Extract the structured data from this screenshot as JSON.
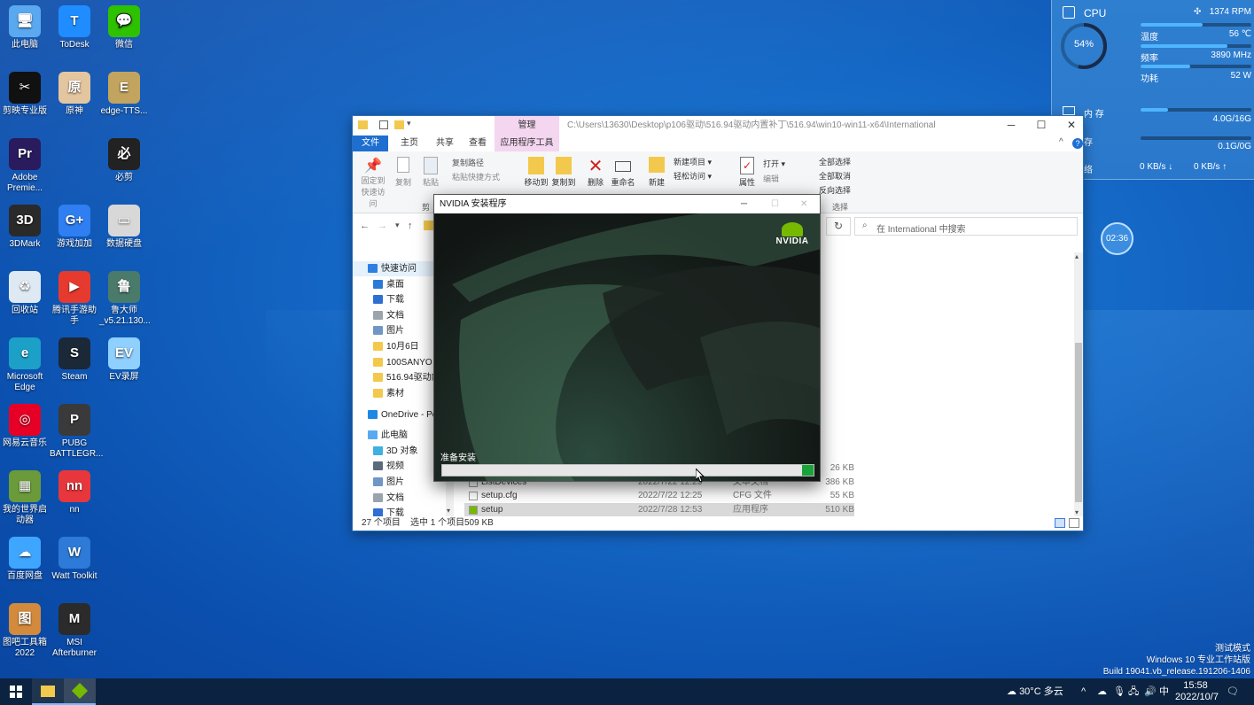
{
  "desktop": {
    "icons": [
      {
        "label": "此电脑",
        "color": "#5aa9f0",
        "glyph": "🖥"
      },
      {
        "label": "ToDesk",
        "color": "#1f8dff",
        "glyph": "T"
      },
      {
        "label": "微信",
        "color": "#2dc100",
        "glyph": "💬"
      },
      {
        "label": "剪映专业版",
        "color": "#111111",
        "glyph": "✂"
      },
      {
        "label": "原神",
        "color": "#e3c6a0",
        "glyph": "原"
      },
      {
        "label": "edge-TTS...",
        "color": "#c2a45e",
        "glyph": "E"
      },
      {
        "label": "Adobe Premie...",
        "color": "#2a1b5e",
        "glyph": "Pr"
      },
      {
        "label": "必剪",
        "color": "#222222",
        "glyph": "必"
      },
      {
        "label": "3DMark",
        "color": "#2a2a2a",
        "glyph": "3D"
      },
      {
        "label": "游戏加加",
        "color": "#2f7ff2",
        "glyph": "G+"
      },
      {
        "label": "数据硬盘",
        "color": "#d8d8d8",
        "glyph": "▭"
      },
      {
        "label": "回收站",
        "color": "#dfe9f3",
        "glyph": "♻"
      },
      {
        "label": "腾讯手游助手",
        "color": "#e63a2f",
        "glyph": "▶"
      },
      {
        "label": "鲁大师_v5.21.130...",
        "color": "#4a7a6a",
        "glyph": "鲁"
      },
      {
        "label": "Microsoft Edge",
        "color": "#1da0c8",
        "glyph": "e"
      },
      {
        "label": "Steam",
        "color": "#1b2838",
        "glyph": "S"
      },
      {
        "label": "EV录屏",
        "color": "#8fd0ff",
        "glyph": "EV"
      },
      {
        "label": "网易云音乐",
        "color": "#e60026",
        "glyph": "◎"
      },
      {
        "label": "PUBG BATTLEGR...",
        "color": "#3a3a3a",
        "glyph": "P"
      },
      {
        "label": "我的世界启动器",
        "color": "#6a9a3a",
        "glyph": "▦"
      },
      {
        "label": "nn",
        "color": "#e8373c",
        "glyph": "nn"
      },
      {
        "label": "百度网盘",
        "color": "#3fa6ff",
        "glyph": "☁"
      },
      {
        "label": "Watt Toolkit",
        "color": "#2d7ad8",
        "glyph": "W"
      },
      {
        "label": "图吧工具箱2022",
        "color": "#d48a3c",
        "glyph": "图"
      },
      {
        "label": "MSI Afterburner",
        "color": "#2b2b2b",
        "glyph": "M"
      }
    ]
  },
  "monitor": {
    "cpu_label": "CPU",
    "fan": "1374 RPM",
    "usage_percent": "54%",
    "usage_value": 0.54,
    "temp_label": "温度",
    "temp": "56 ℃",
    "temp_level": 0.56,
    "freq_label": "频率",
    "freq": "3890 MHz",
    "freq_level": 0.78,
    "power_label": "功耗",
    "power": "52 W",
    "power_level": 0.45,
    "mem_label": "内 存",
    "mem": "4.0G/16G",
    "mem_level": 0.25,
    "disk_label": "存",
    "disk": "0.1G/0G",
    "disk_level": 0.0,
    "net_label": "络",
    "net_down": "0 KB/s ↓",
    "net_up": "0 KB/s ↑"
  },
  "clock_widget": "02:36",
  "explorer": {
    "manage_tab": "管理",
    "path": "C:\\Users\\13630\\Desktop\\p106驱动\\516.94驱动内置补丁\\516.94\\win10-win11-x64\\International",
    "tabs": [
      "文件",
      "主页",
      "共享",
      "查看",
      "应用程序工具"
    ],
    "ribbon": {
      "pin": "固定到快速访问",
      "copy": "复制",
      "paste": "粘贴",
      "copy_path": "复制路径",
      "paste_shortcut": "粘贴快捷方式",
      "cut": "剪",
      "move_to": "移动到",
      "copy_to": "复制到",
      "delete": "删除",
      "rename": "重命名",
      "new_folder": "新建",
      "new_item": "新建项目 ▾",
      "easy_access": "轻松访问 ▾",
      "properties": "属性",
      "open": "打开 ▾",
      "edit": "编辑",
      "select_all": "全部选择",
      "select_none": "全部取消",
      "invert": "反向选择",
      "select_group": "选择"
    },
    "search_placeholder": "在 International 中搜索",
    "nav": [
      {
        "label": "快速访问",
        "color": "#2f7fe0",
        "indent": 0
      },
      {
        "label": "桌面",
        "color": "#2b7ad6",
        "indent": 1
      },
      {
        "label": "下载",
        "color": "#2e6fd1",
        "indent": 1
      },
      {
        "label": "文档",
        "color": "#9aa4ad",
        "indent": 1
      },
      {
        "label": "图片",
        "color": "#6f97c5",
        "indent": 1
      },
      {
        "label": "10月6日",
        "color": "#f2c94c",
        "indent": 1
      },
      {
        "label": "100SANYO",
        "color": "#f2c94c",
        "indent": 1
      },
      {
        "label": "516.94驱动内",
        "color": "#f2c94c",
        "indent": 1
      },
      {
        "label": "素材",
        "color": "#f2c94c",
        "indent": 1
      },
      {
        "label": "OneDrive - Pe",
        "color": "#1e88e5",
        "indent": 0
      },
      {
        "label": "此电脑",
        "color": "#5aa9f0",
        "indent": 0
      },
      {
        "label": "3D 对象",
        "color": "#3fb0e0",
        "indent": 1
      },
      {
        "label": "视频",
        "color": "#5b6b7a",
        "indent": 1
      },
      {
        "label": "图片",
        "color": "#6f97c5",
        "indent": 1
      },
      {
        "label": "文档",
        "color": "#9aa4ad",
        "indent": 1
      },
      {
        "label": "下载",
        "color": "#2e6fd1",
        "indent": 1
      }
    ],
    "files": [
      {
        "name": "",
        "date": "",
        "type": "",
        "size": "26 KB"
      },
      {
        "name": "ListDevices",
        "date": "2022/7/22 12:25",
        "type": "文本文档",
        "size": "386 KB"
      },
      {
        "name": "setup.cfg",
        "date": "2022/7/22 12:25",
        "type": "CFG 文件",
        "size": "55 KB"
      },
      {
        "name": "setup",
        "date": "2022/7/28 12:53",
        "type": "应用程序",
        "size": "510 KB"
      }
    ],
    "status": {
      "count": "27 个项目",
      "selected": "选中 1 个项目",
      "size": "509 KB"
    }
  },
  "installer": {
    "title": "NVIDIA 安装程序",
    "brand": "NVIDIA",
    "status": "准备安装",
    "progress": 0.03
  },
  "watermark": {
    "line1": "测试模式",
    "line2": "Windows 10 专业工作站版",
    "line3": "Build 19041.vb_release.191206-1406"
  },
  "taskbar": {
    "weather": "30°C 多云",
    "ime": "中",
    "time": "15:58",
    "date": "2022/10/7"
  }
}
